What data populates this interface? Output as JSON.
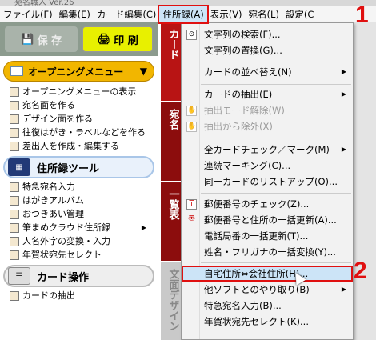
{
  "window": {
    "title": "宛名職人 Ver.26"
  },
  "menubar": [
    {
      "label": "ファイル(F)"
    },
    {
      "label": "編集(E)"
    },
    {
      "label": "カード編集(C)"
    },
    {
      "label": "住所録(A)"
    },
    {
      "label": "表示(V)"
    },
    {
      "label": "宛名(L)"
    },
    {
      "label": "設定(C"
    }
  ],
  "toolbar": {
    "save_label": "保 存",
    "print_label": "印 刷"
  },
  "opening_menu": {
    "label": "オープニングメニュー"
  },
  "opening_items": [
    {
      "label": "オープニングメニューの表示"
    },
    {
      "label": "宛名面を作る"
    },
    {
      "label": "デザイン面を作る"
    },
    {
      "label": "往復はがき・ラベルなどを作る"
    },
    {
      "label": "差出人を作成・編集する"
    }
  ],
  "address_tools": {
    "label": "住所録ツール"
  },
  "address_items": [
    {
      "label": "特急宛名入力"
    },
    {
      "label": "はがきアルバム"
    },
    {
      "label": "おつきあい管理"
    },
    {
      "label": "筆まめクラウド住所録",
      "submenu": "▶"
    },
    {
      "label": "人名外字の変換・入力"
    },
    {
      "label": "年賀状宛先セレクト"
    }
  ],
  "card_ops": {
    "label": "カード操作",
    "first_item": "カードの抽出"
  },
  "tabs": [
    {
      "label": "カード"
    },
    {
      "label": "宛名"
    },
    {
      "label": "一覧表"
    },
    {
      "label": "文面デザイン"
    }
  ],
  "dropdown": {
    "items": [
      {
        "label": "文字列の検索(F)...",
        "icon": "binoculars-icon"
      },
      {
        "label": "文字列の置換(G)..."
      },
      {
        "label": "カードの並べ替え(N)",
        "submenu": "▶"
      },
      {
        "label": "カードの抽出(E)",
        "submenu": "▶"
      },
      {
        "label": "抽出モード解除(W)",
        "disabled": true
      },
      {
        "label": "抽出から除外(X)",
        "disabled": true
      },
      {
        "label": "全カードチェック／マーク(M)",
        "submenu": "▶"
      },
      {
        "label": "連続マーキング(C)..."
      },
      {
        "label": "同一カードのリストアップ(O)..."
      },
      {
        "label": "郵便番号のチェック(Z)...",
        "icon": "postal-icon"
      },
      {
        "label": "郵便番号と住所の一括更新(A)...",
        "icon": "postal-update-icon"
      },
      {
        "label": "電話局番の一括更新(T)..."
      },
      {
        "label": "姓名・フリガナの一括変換(Y)..."
      },
      {
        "label": "自宅住所⇔会社住所(H)..."
      },
      {
        "label": "他ソフトとのやり取り(B)",
        "submenu": "▶"
      },
      {
        "label": "特急宛名入力(B)..."
      },
      {
        "label": "年賀状宛先セレクト(K)..."
      }
    ]
  },
  "callouts": {
    "first": "1",
    "second": "2"
  },
  "colors": {
    "accent_red": "#e01010",
    "highlight": "#cce4f7",
    "tab_red": "#b81414"
  }
}
